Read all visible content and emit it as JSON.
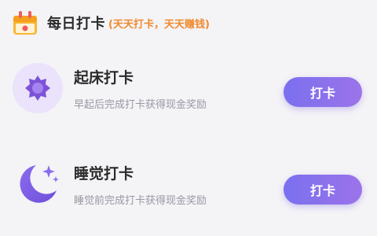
{
  "header": {
    "icon": "calendar-gift-icon",
    "title": "每日打卡",
    "subtitle": "(天天打卡，天天赚钱)"
  },
  "tasks": [
    {
      "icon": "sun-icon",
      "title": "起床打卡",
      "description": "早起后完成打卡获得现金奖励",
      "button_label": "打卡"
    },
    {
      "icon": "moon-stars-icon",
      "title": "睡觉打卡",
      "description": "睡觉前完成打卡获得现金奖励",
      "button_label": "打卡"
    }
  ],
  "colors": {
    "accent_start": "#7a70ee",
    "accent_end": "#9c73ea",
    "subtitle": "#f08a2c"
  }
}
